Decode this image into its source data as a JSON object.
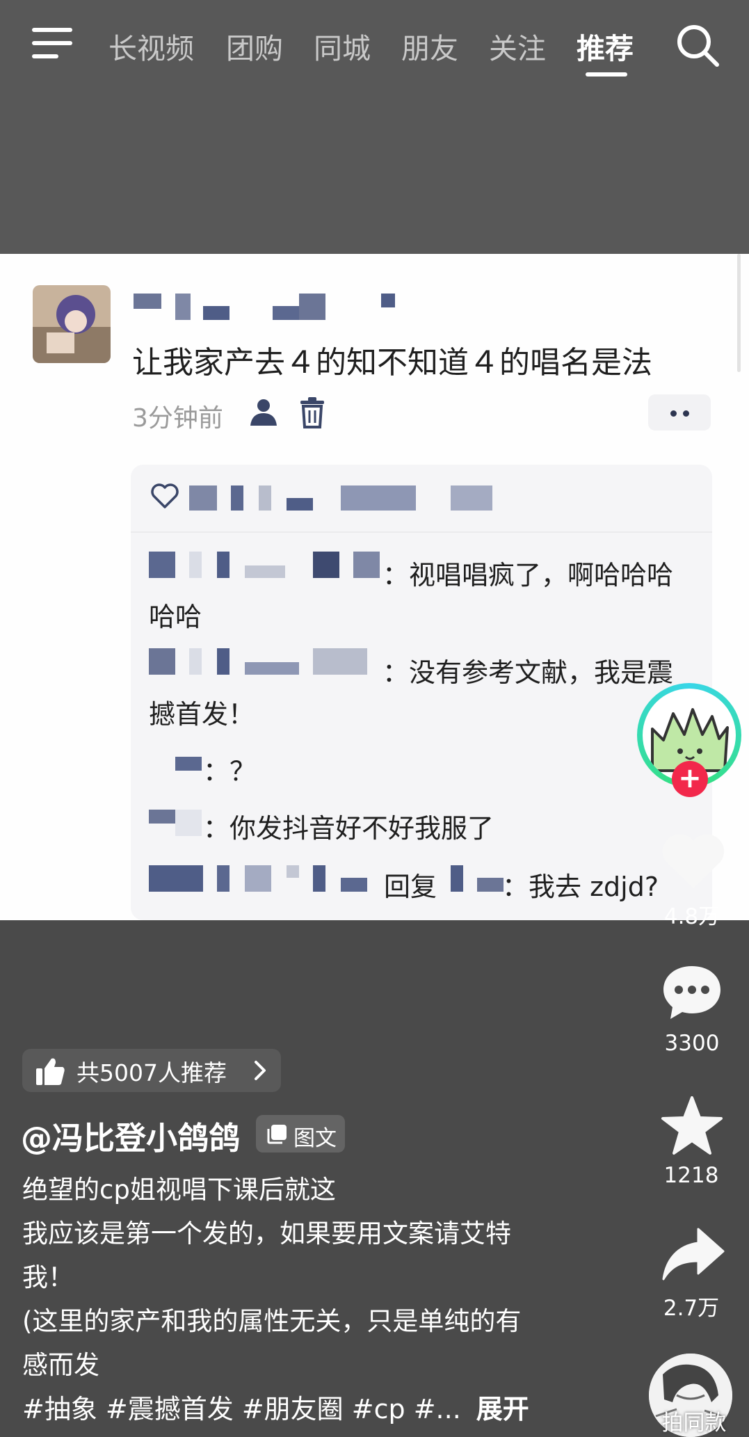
{
  "topnav": {
    "tabs": [
      "长视频",
      "团购",
      "同城",
      "朋友",
      "关注",
      "推荐"
    ],
    "active_tab": "推荐"
  },
  "screenshot_post": {
    "comment_text": "让我家产去４的知不知道４的唱名是法",
    "timestamp": "3分钟前",
    "replies": [
      {
        "text_line1": "：视唱唱疯了，啊哈哈哈",
        "text_line2": "哈哈"
      },
      {
        "text_line1": "：没有参考文献，我是震",
        "text_line2": "撼首发！"
      },
      {
        "text_line1": "：？"
      },
      {
        "text_line1": "：你发抖音好不好我服了"
      },
      {
        "reply_word": "回复",
        "text_line1": "：我去 zdjd?"
      }
    ]
  },
  "rail": {
    "likes": "4.8万",
    "comments": "3300",
    "favorites": "1218",
    "shares": "2.7万",
    "same_style_label": "拍同款"
  },
  "info": {
    "recommend_text": "共5007人推荐",
    "author": "@冯比登小鸽鸽",
    "type_badge": "图文",
    "desc_lines": [
      "绝望的cp姐视唱下课后就这",
      "我应该是第一个发的，如果要用文案请艾特",
      "我！",
      "(这里的家产和我的属性无关，只是单纯的有",
      "感而发"
    ],
    "tags": "#抽象 #震撼首发 #朋友圈 #cp #...",
    "expand_label": "展开"
  },
  "colors": {
    "like_red": "#f2284b",
    "ring_cyan": "#38d6e8",
    "ring_green": "#34e07a"
  }
}
